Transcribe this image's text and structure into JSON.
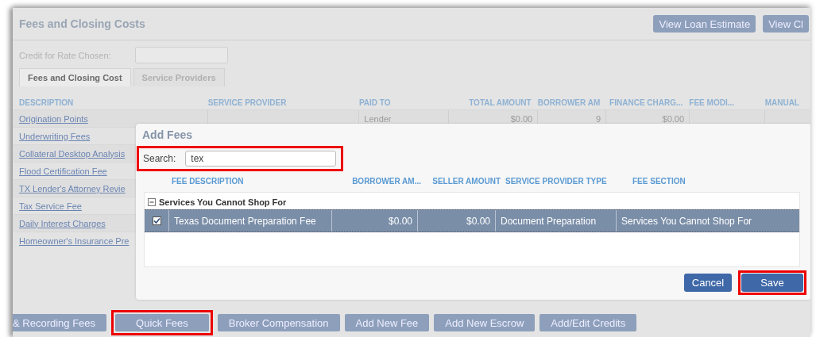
{
  "page": {
    "title": "Fees and Closing Costs",
    "header_buttons": [
      "View Loan Estimate",
      "View Cl"
    ],
    "credit_label": "Credit for Rate Chosen:",
    "tabs": [
      {
        "label": "Fees and Closing Cost",
        "selected": true
      },
      {
        "label": "Service Providers",
        "selected": false
      }
    ],
    "table": {
      "columns": [
        "DESCRIPTION",
        "SERVICE PROVIDER",
        "PAID TO",
        "TOTAL AMOUNT",
        "BORROWER AM",
        "FINANCE CHARG...",
        "FEE MODI...",
        "MANUAL"
      ],
      "rows": [
        {
          "description": "Origination Points",
          "paid_to": "Lender",
          "total_amount": "$0.00",
          "borrower_amount": "9",
          "finance_charge": "$0.00"
        },
        {
          "description": "Underwriting Fees"
        },
        {
          "description": "Collateral Desktop Analysis"
        },
        {
          "description": "Flood Certification Fee"
        },
        {
          "description": "TX Lender's Attorney Revie"
        },
        {
          "description": "Tax Service Fee"
        },
        {
          "description": "Daily Interest Charges"
        },
        {
          "description": "Homeowner's Insurance Pre"
        }
      ]
    },
    "bottom_buttons": [
      {
        "label": "& Recording Fees",
        "highlighted": false
      },
      {
        "label": "Quick Fees",
        "highlighted": true
      },
      {
        "label": "Broker Compensation",
        "highlighted": false
      },
      {
        "label": "Add New Fee",
        "highlighted": false
      },
      {
        "label": "Add New Escrow",
        "highlighted": false
      },
      {
        "label": "Add/Edit Credits",
        "highlighted": false
      }
    ]
  },
  "dialog": {
    "title": "Add Fees",
    "search": {
      "label": "Search:",
      "value": "tex",
      "highlighted": true
    },
    "columns": [
      "FEE DESCRIPTION",
      "BORROWER AM...",
      "SELLER AMOUNT",
      "SERVICE PROVIDER TYPE",
      "FEE SECTION"
    ],
    "group": {
      "label": "Services You Cannot Shop For",
      "expanded": true
    },
    "rows": [
      {
        "checked": true,
        "selected": true,
        "fee_description": "Texas Document Preparation Fee",
        "borrower_amount": "$0.00",
        "seller_amount": "$0.00",
        "service_provider_type": "Document Preparation",
        "fee_section": "Services You Cannot Shop For"
      }
    ],
    "buttons": [
      {
        "label": "Cancel",
        "highlighted": false
      },
      {
        "label": "Save",
        "highlighted": true
      }
    ]
  }
}
